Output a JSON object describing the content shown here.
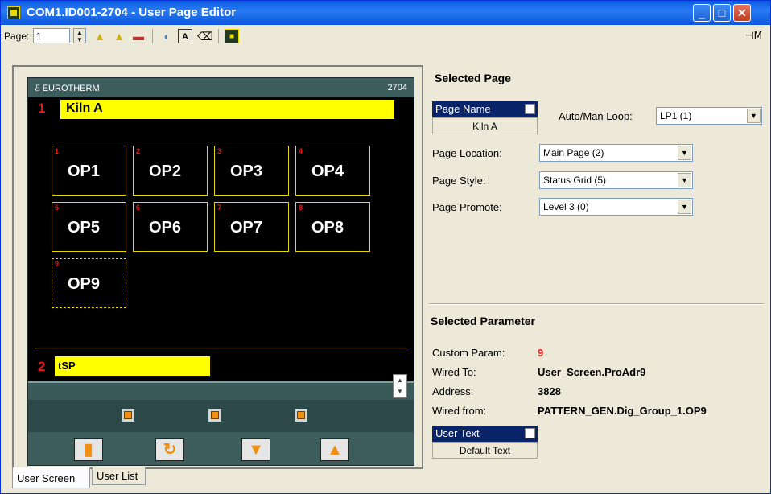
{
  "window": {
    "title": "COM1.ID001-2704 - User Page Editor"
  },
  "toolbar": {
    "page_label": "Page:",
    "page_value": "1",
    "pin": "⊣Ⅿ"
  },
  "device": {
    "brand": "ℰ EUROTHERM",
    "model": "2704",
    "row1_num": "1",
    "page_title": "Kiln A",
    "tiles": [
      {
        "n": "1",
        "label": "OP1"
      },
      {
        "n": "2",
        "label": "OP2"
      },
      {
        "n": "3",
        "label": "OP3"
      },
      {
        "n": "4",
        "label": "OP4"
      },
      {
        "n": "5",
        "label": "OP5"
      },
      {
        "n": "6",
        "label": "OP6"
      },
      {
        "n": "7",
        "label": "OP7"
      },
      {
        "n": "8",
        "label": "OP8"
      },
      {
        "n": "9",
        "label": "OP9"
      }
    ],
    "row2_num": "2",
    "param_label": "tSP"
  },
  "tabs": {
    "user_screen": "User Screen",
    "user_list": "User List"
  },
  "selected_page": {
    "title": "Selected Page",
    "page_name_label": "Page Name",
    "page_name_value": "Kiln A",
    "auto_man_label": "Auto/Man Loop:",
    "auto_man_value": "LP1 (1)",
    "location_label": "Page Location:",
    "location_value": "Main Page (2)",
    "style_label": "Page Style:",
    "style_value": "Status Grid (5)",
    "promote_label": "Page Promote:",
    "promote_value": "Level 3 (0)"
  },
  "selected_param": {
    "title": "Selected Parameter",
    "custom_label": "Custom Param:",
    "custom_value": "9",
    "wired_to_label": "Wired To:",
    "wired_to_value": "User_Screen.ProAdr9",
    "address_label": "Address:",
    "address_value": "3828",
    "wired_from_label": "Wired from:",
    "wired_from_value": "PATTERN_GEN.Dig_Group_1.OP9",
    "user_text_label": "User Text",
    "user_text_value": "Default Text"
  }
}
